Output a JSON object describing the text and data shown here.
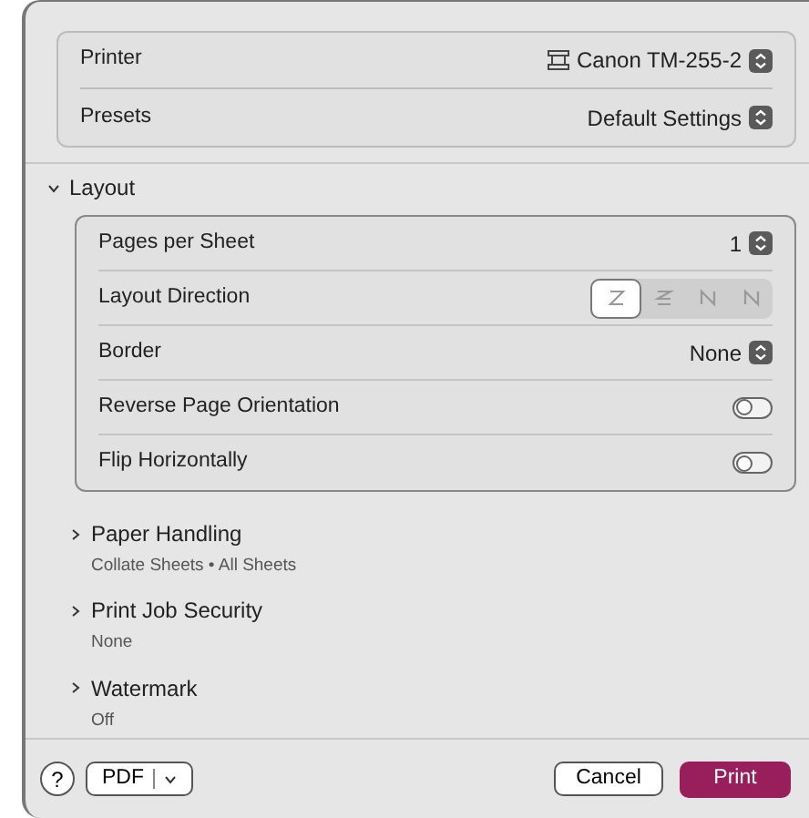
{
  "top_settings": [
    {
      "label": "Printer",
      "value": "Canon TM-255-2",
      "has_printer_icon": true
    },
    {
      "label": "Presets",
      "value": "Default Settings",
      "has_printer_icon": false
    }
  ],
  "sections": [
    {
      "title": "Layout",
      "expanded": true,
      "settings": [
        {
          "kind": "popup",
          "label": "Pages per Sheet",
          "value": "1"
        },
        {
          "kind": "segmented",
          "label": "Layout Direction",
          "options": [
            {
              "selected": true
            },
            {
              "selected": false
            },
            {
              "selected": false
            },
            {
              "selected": false
            }
          ]
        },
        {
          "kind": "popup",
          "label": "Border",
          "value": "None"
        },
        {
          "kind": "toggle",
          "label": "Reverse Page Orientation",
          "on": false
        },
        {
          "kind": "toggle",
          "label": "Flip Horizontally",
          "on": false
        }
      ]
    },
    {
      "title": "Paper Handling",
      "expanded": false,
      "summary": "Collate Sheets • All Sheets"
    },
    {
      "title": "Print Job Security",
      "expanded": false,
      "summary": "None"
    },
    {
      "title": "Watermark",
      "expanded": false,
      "summary": "Off"
    }
  ],
  "footer": {
    "help": "?",
    "pdf": "PDF",
    "cancel": "Cancel",
    "print": "Print"
  }
}
